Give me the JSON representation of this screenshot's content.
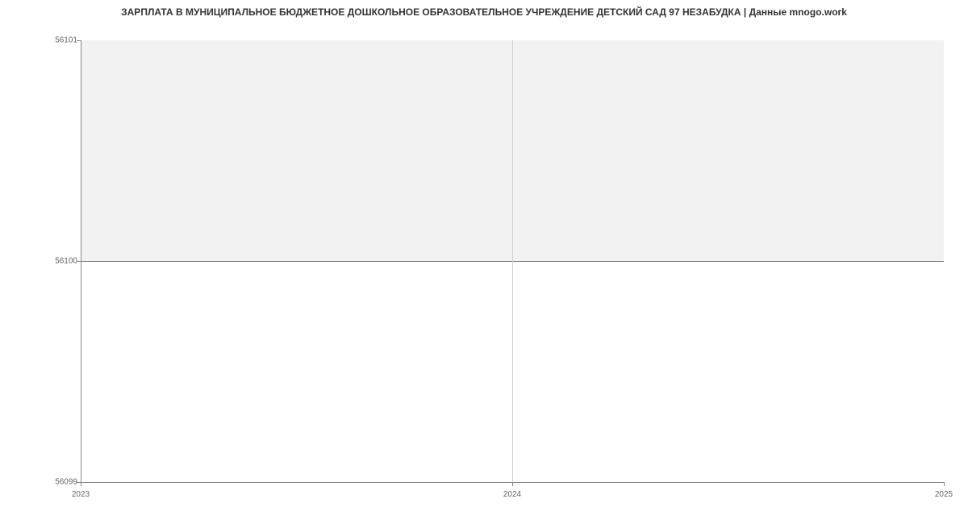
{
  "chart_data": {
    "type": "area",
    "title": "ЗАРПЛАТА В МУНИЦИПАЛЬНОЕ БЮДЖЕТНОЕ ДОШКОЛЬНОЕ ОБРАЗОВАТЕЛЬНОЕ УЧРЕЖДЕНИЕ ДЕТСКИЙ САД 97 НЕЗАБУДКА | Данные mnogo.work",
    "x": [
      2023,
      2024,
      2025
    ],
    "values": [
      56100,
      56100,
      56100
    ],
    "xlabel": "",
    "ylabel": "",
    "xlim": [
      2023,
      2025
    ],
    "ylim": [
      56099,
      56101
    ],
    "x_ticks": [
      "2023",
      "2024",
      "2025"
    ],
    "y_ticks": [
      "56099",
      "56100",
      "56101"
    ],
    "line_color": "#4a7fd6",
    "fill_color": "#f2f2f2"
  }
}
